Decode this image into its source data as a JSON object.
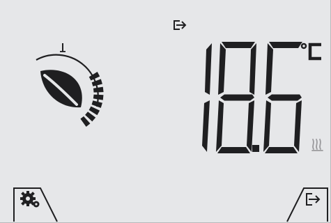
{
  "thermostat": {
    "temperature": "18.6",
    "unit": "°C",
    "mode_icon": "exit-icon",
    "heating_icon": "heat-waves-icon",
    "eco_icon": "leaf-icon"
  },
  "setpoint_dial": {
    "level_segments_lit": 8,
    "level_segments_total": 8
  },
  "buttons": {
    "settings": {
      "icon": "gears-icon"
    },
    "exit": {
      "icon": "exit-icon"
    }
  },
  "colors": {
    "background": "#e6e7e9",
    "ink": "#1f1f21",
    "heating_icon": "#9a9a9d"
  }
}
